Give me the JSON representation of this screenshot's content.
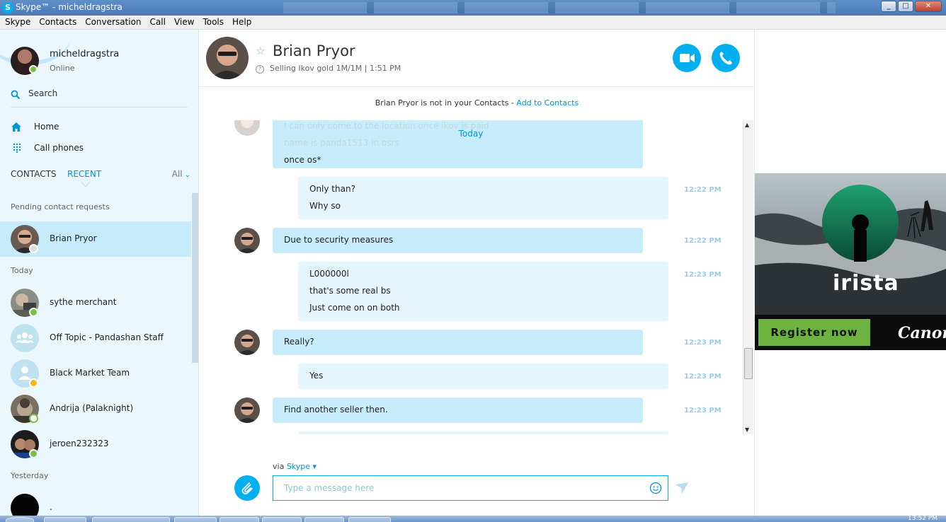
{
  "window": {
    "title": "Skype™ - micheldragstra"
  },
  "menu": [
    "Skype",
    "Contacts",
    "Conversation",
    "Call",
    "View",
    "Tools",
    "Help"
  ],
  "colors": {
    "accent": "#00aff0",
    "link": "#0093d6",
    "incoming_bubble": "#c7ecfc",
    "outgoing_bubble": "#e4f5fc",
    "online": "#7ac143",
    "away": "#f5b915"
  },
  "profile": {
    "name": "micheldragstra",
    "status": "Online"
  },
  "search": {
    "label": "Search"
  },
  "nav": {
    "home": "Home",
    "call_phones": "Call phones"
  },
  "tabs": {
    "contacts": "CONTACTS",
    "recent": "RECENT",
    "filter": "All"
  },
  "sections": {
    "pending": "Pending contact requests",
    "today": "Today",
    "yesterday": "Yesterday"
  },
  "contacts": [
    {
      "name": "Brian Pryor",
      "status": "unknown"
    },
    {
      "name": "sythe merchant",
      "status": "online"
    },
    {
      "name": "Off Topic - Pandashan Staff",
      "status": "group"
    },
    {
      "name": "Black Market Team",
      "status": "away"
    },
    {
      "name": "Andrija (Palaknight)",
      "status": "offline"
    },
    {
      "name": "jeroen232323",
      "status": "online"
    },
    {
      "name": ".",
      "status": "online"
    }
  ],
  "header": {
    "name": "Brian Pryor",
    "mood": "Selling Ikov gold 1M/1M",
    "local_time": "1:51 PM"
  },
  "notice": {
    "text": "Brian Pryor is not in your Contacts - ",
    "link": "Add to Contacts"
  },
  "day_separator": "Today",
  "messages": [
    {
      "direction": "in",
      "lines": [
        "I can only come to the location once ikov is paid",
        "name is panda1513 in osrs",
        "once os*"
      ],
      "time": ""
    },
    {
      "direction": "out",
      "lines": [
        "Only than?",
        "Why so"
      ],
      "time": "12:22 PM"
    },
    {
      "direction": "in",
      "lines": [
        "Due to security measures"
      ],
      "time": "12:22 PM"
    },
    {
      "direction": "out",
      "lines": [
        "L000000l",
        "that's some real bs",
        "Just come on on both"
      ],
      "time": "12:23 PM"
    },
    {
      "direction": "in",
      "lines": [
        "Really?"
      ],
      "time": "12:23 PM"
    },
    {
      "direction": "out",
      "lines": [
        "Yes"
      ],
      "time": "12:23 PM"
    },
    {
      "direction": "in",
      "lines": [
        "Find another seller then."
      ],
      "time": "12:23 PM"
    }
  ],
  "composer": {
    "via_prefix": "via",
    "via_link": "Skype",
    "placeholder": "Type a message here"
  },
  "ad": {
    "brand": "irista",
    "button": "Register now",
    "sponsor": "Canon"
  },
  "taskbar": {
    "clock": "13:52 PM"
  }
}
